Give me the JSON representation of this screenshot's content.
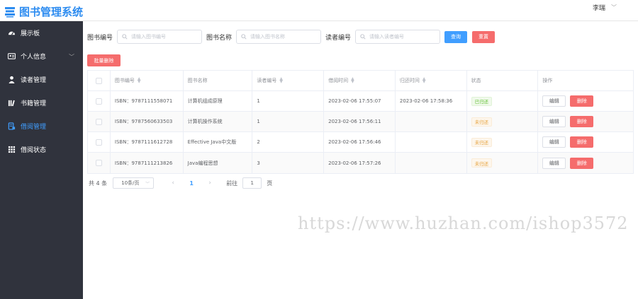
{
  "app": {
    "title": "图书管理系统",
    "user": "李瑞"
  },
  "sidebar": {
    "items": [
      {
        "label": "展示板",
        "icon": "dashboard-icon"
      },
      {
        "label": "个人信息",
        "icon": "id-card-icon"
      },
      {
        "label": "读者管理",
        "icon": "user-icon"
      },
      {
        "label": "书籍管理",
        "icon": "books-icon"
      },
      {
        "label": "借阅管理",
        "icon": "borrow-icon"
      },
      {
        "label": "借阅状态",
        "icon": "grid-icon"
      }
    ]
  },
  "search": {
    "book_id_label": "图书编号",
    "book_id_placeholder": "请输入图书编号",
    "book_name_label": "图书名称",
    "book_name_placeholder": "请输入图书名称",
    "reader_id_label": "读者编号",
    "reader_id_placeholder": "请输入读者编号",
    "query_label": "查询",
    "reset_label": "重置"
  },
  "batch_delete_label": "批量删除",
  "table": {
    "headers": [
      "图书编号",
      "图书名称",
      "读者编号",
      "借阅时间",
      "归还时间",
      "状态",
      "操作"
    ],
    "rows": [
      {
        "isbn": "ISBN：9787111558071",
        "name": "计算机组成原理",
        "reader": "1",
        "borrow": "2023-02-06 17:55:07",
        "return": "2023-02-06 17:58:36",
        "status": "已归还",
        "status_type": "ok"
      },
      {
        "isbn": "ISBN：9787560633503",
        "name": "计算机操作系统",
        "reader": "1",
        "borrow": "2023-02-06 17:56:11",
        "return": "",
        "status": "未归还",
        "status_type": "warn"
      },
      {
        "isbn": "ISBN：9787111612728",
        "name": "Effective Java中文版",
        "reader": "2",
        "borrow": "2023-02-06 17:56:46",
        "return": "",
        "status": "未归还",
        "status_type": "warn"
      },
      {
        "isbn": "ISBN：9787111213826",
        "name": "Java编程思想",
        "reader": "3",
        "borrow": "2023-02-06 17:57:26",
        "return": "",
        "status": "未归还",
        "status_type": "warn"
      }
    ],
    "edit_label": "编辑",
    "delete_label": "删除"
  },
  "pager": {
    "total": "共 4 条",
    "page_size": "10条/页",
    "current_page": "1",
    "goto_label": "前往",
    "goto_value": "1",
    "page_suffix": "页"
  },
  "watermark": "https://www.huzhan.com/ishop3572",
  "colors": {
    "primary": "#409eff",
    "danger": "#f56c6c",
    "sidebar": "#30333d"
  }
}
